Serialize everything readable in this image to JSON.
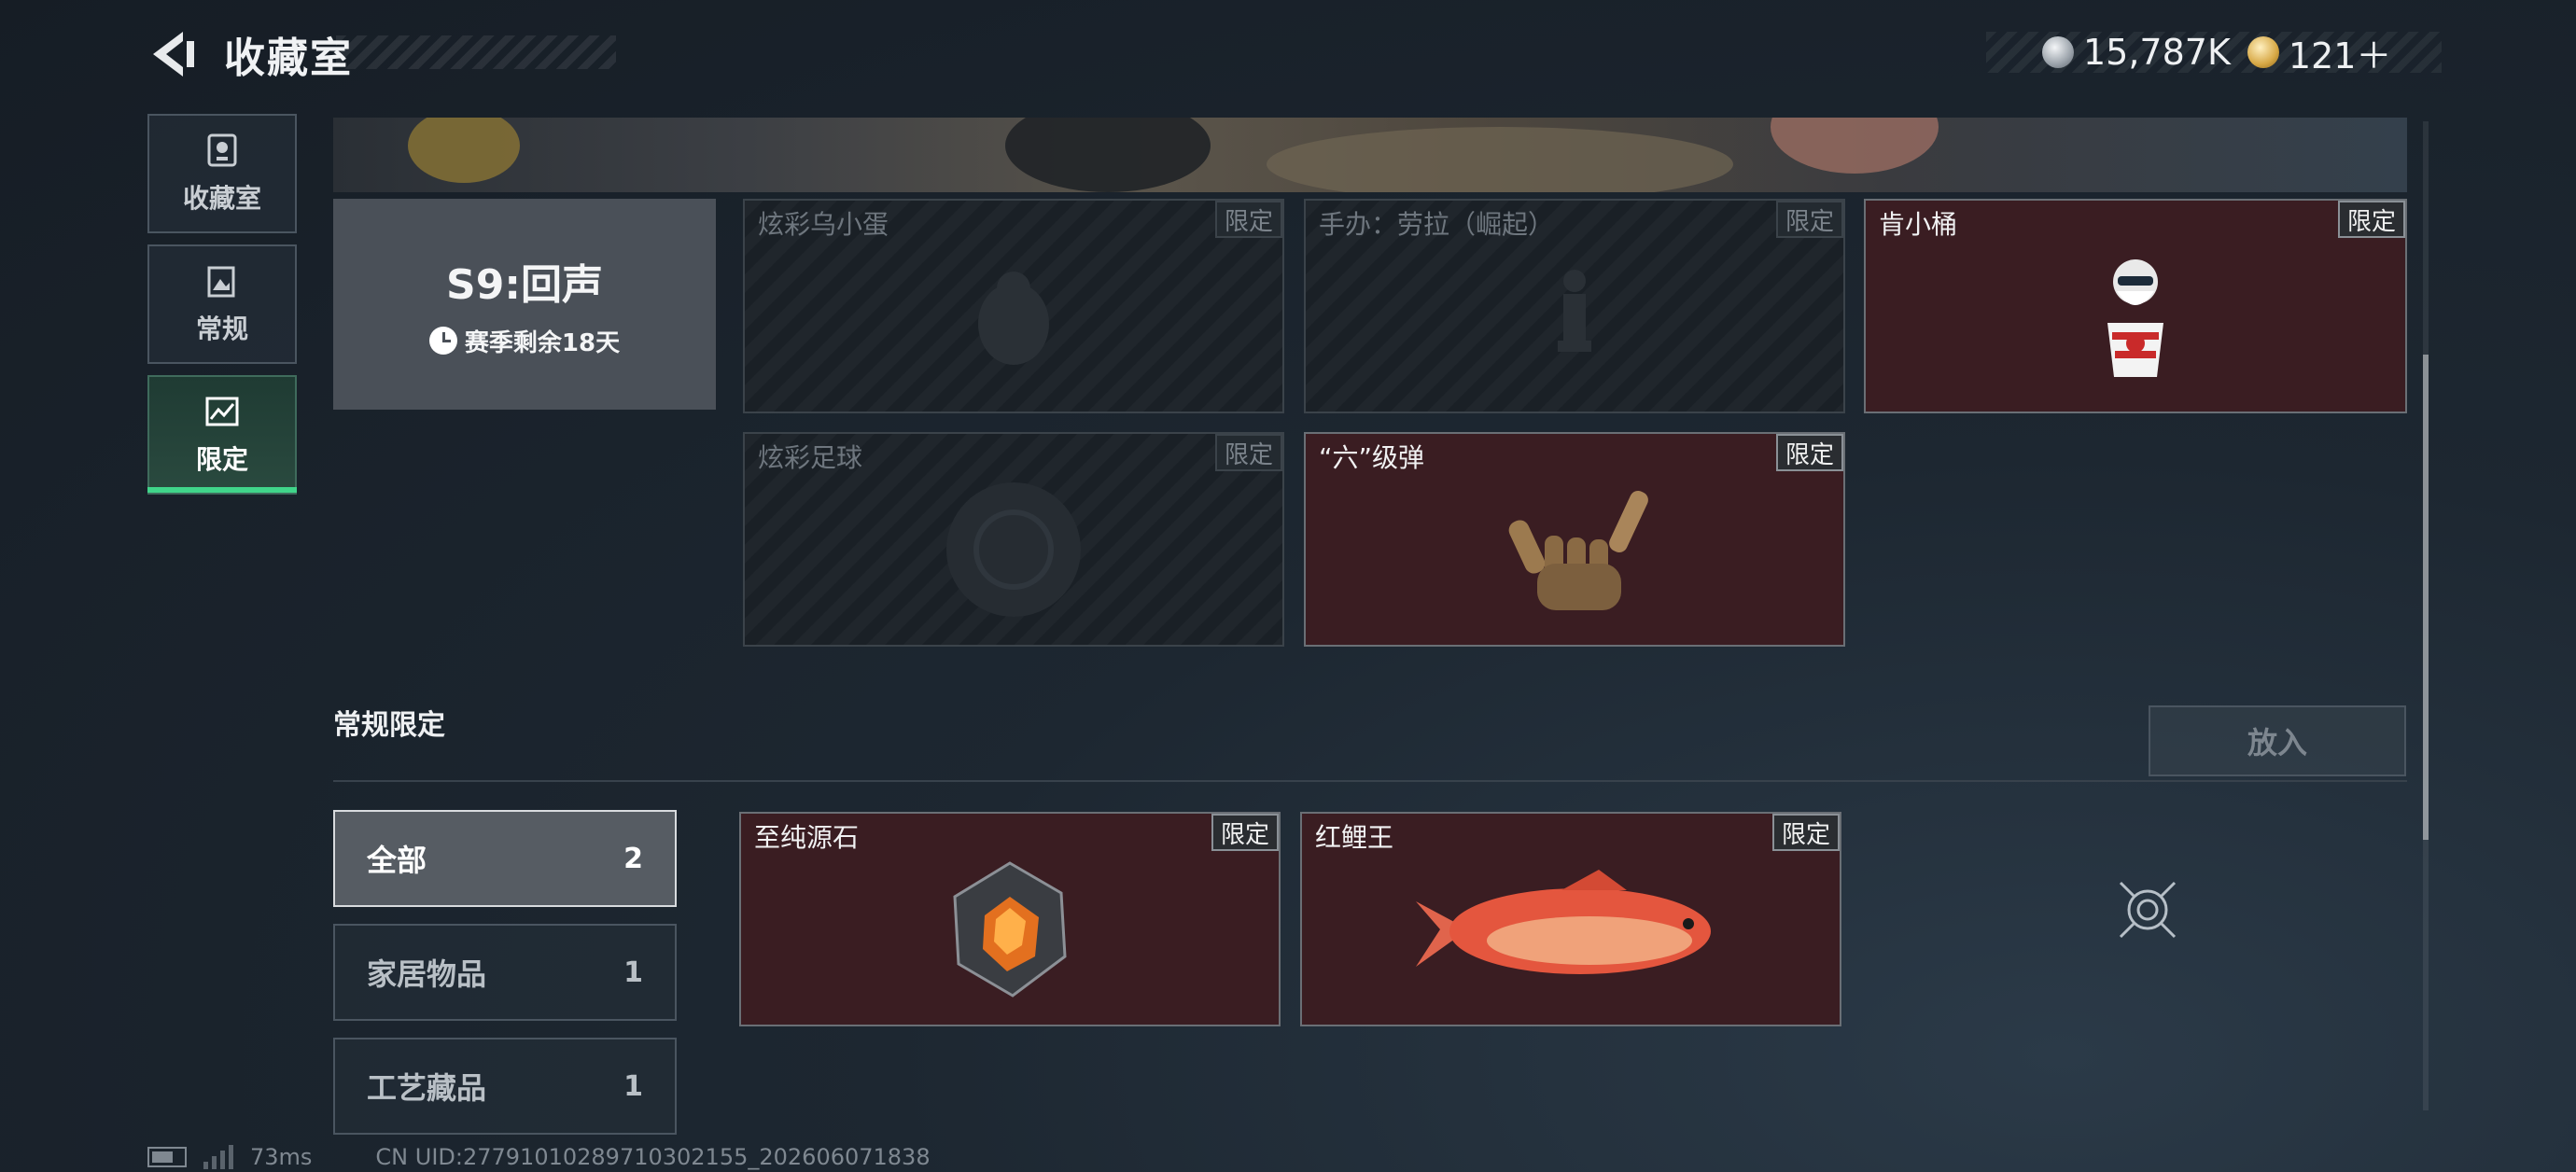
{
  "header": {
    "title": "收藏室",
    "currency": [
      {
        "icon": "silver-coin-icon",
        "value": "15,787K"
      },
      {
        "icon": "gold-coin-icon",
        "value": "121＋"
      }
    ]
  },
  "nav": [
    {
      "label": "收藏室",
      "icon": "trophy-icon",
      "active": false
    },
    {
      "label": "常规",
      "icon": "picture-book-icon",
      "active": false
    },
    {
      "label": "限定",
      "icon": "map-icon",
      "active": true
    }
  ],
  "season": {
    "name": "S9:回声",
    "remaining": "赛季剩余18天"
  },
  "limited_items": [
    {
      "name": "炫彩乌小蛋",
      "tag": "限定",
      "owned": false,
      "icon": "egg-figure-icon"
    },
    {
      "name": "手办：劳拉（崛起）",
      "tag": "限定",
      "owned": false,
      "icon": "figure-icon"
    },
    {
      "name": "肯小桶",
      "tag": "限定",
      "owned": true,
      "icon": "kfc-bucket-figure-icon"
    },
    {
      "name": "炫彩足球",
      "tag": "限定",
      "owned": false,
      "icon": "football-icon"
    },
    {
      "name": "“六”级弹",
      "tag": "限定",
      "owned": true,
      "icon": "bullet-hand-icon"
    }
  ],
  "section2": {
    "title": "常规限定",
    "put_button": "放入",
    "filters": [
      {
        "label": "全部",
        "count": "2",
        "active": true
      },
      {
        "label": "家居物品",
        "count": "1",
        "active": false
      },
      {
        "label": "工艺藏品",
        "count": "1",
        "active": false
      }
    ],
    "items": [
      {
        "name": "至纯源石",
        "tag": "限定",
        "owned": true,
        "icon": "gem-stone-icon"
      },
      {
        "name": "红鲤王",
        "tag": "限定",
        "owned": true,
        "icon": "red-carp-icon"
      }
    ]
  },
  "footer": {
    "ping": "73ms",
    "uid": "CN UID:27791010289710302155_202606071838"
  },
  "colors": {
    "accent_green": "#40d58a",
    "owned_card_bg": "#3a1d22",
    "background": "#1d2731"
  }
}
